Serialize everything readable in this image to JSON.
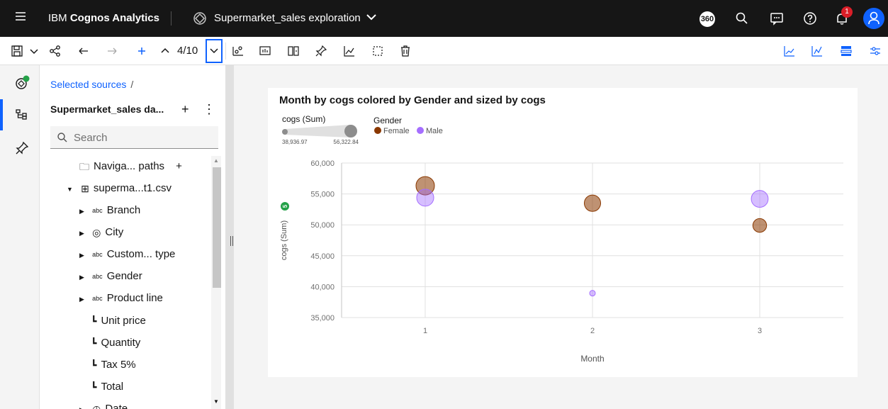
{
  "header": {
    "brand_prefix": "IBM",
    "brand_name": "Cognos Analytics",
    "exploration_title": "Supermarket_sales exploration",
    "badge_360": "360",
    "notification_count": "1"
  },
  "toolbar": {
    "page_indicator": "4/10"
  },
  "panel": {
    "breadcrumb": "Selected sources",
    "breadcrumb_sep": "/",
    "source_name": "Supermarket_sales da...",
    "search_placeholder": "Search",
    "tree": [
      {
        "label": "Naviga... paths",
        "icon": "folder-icon",
        "plus": "+"
      },
      {
        "label": "superma...t1.csv",
        "icon": "table-icon"
      },
      {
        "label": "Branch",
        "icon": "abc-icon",
        "prefix": "abc"
      },
      {
        "label": "City",
        "icon": "location-icon"
      },
      {
        "label": "Custom... type",
        "icon": "abc-icon",
        "prefix": "abc"
      },
      {
        "label": "Gender",
        "icon": "abc-icon",
        "prefix": "abc"
      },
      {
        "label": "Product line",
        "icon": "abc-icon",
        "prefix": "abc"
      },
      {
        "label": "Unit price",
        "icon": "measure-icon"
      },
      {
        "label": "Quantity",
        "icon": "measure-icon"
      },
      {
        "label": "Tax 5%",
        "icon": "measure-icon"
      },
      {
        "label": "Total",
        "icon": "measure-icon"
      },
      {
        "label": "Date",
        "icon": "clock-icon"
      }
    ]
  },
  "chart_badge": "5",
  "chart_data": {
    "type": "scatter",
    "title": "Month by cogs colored by Gender and sized by cogs",
    "xlabel": "Month",
    "ylabel": "cogs (Sum)",
    "categories": [
      "1",
      "2",
      "3"
    ],
    "ylim": [
      35000,
      60000
    ],
    "yticks": [
      "60,000",
      "55,000",
      "50,000",
      "45,000",
      "40,000",
      "35,000"
    ],
    "yticks_values": [
      60000,
      55000,
      50000,
      45000,
      40000,
      35000
    ],
    "size_legend": {
      "title": "cogs (Sum)",
      "min_label": "38,936.97",
      "max_label": "56,322.84",
      "min": 38936.97,
      "max": 56322.84
    },
    "color_legend_title": "Gender",
    "series": [
      {
        "name": "Female",
        "color": "#8a3800",
        "values": [
          56322.84,
          53500,
          49900
        ]
      },
      {
        "name": "Male",
        "color": "#a56eff",
        "values": [
          54400,
          38936.97,
          54200
        ]
      }
    ],
    "grid": true,
    "legend_position": "top-left"
  }
}
